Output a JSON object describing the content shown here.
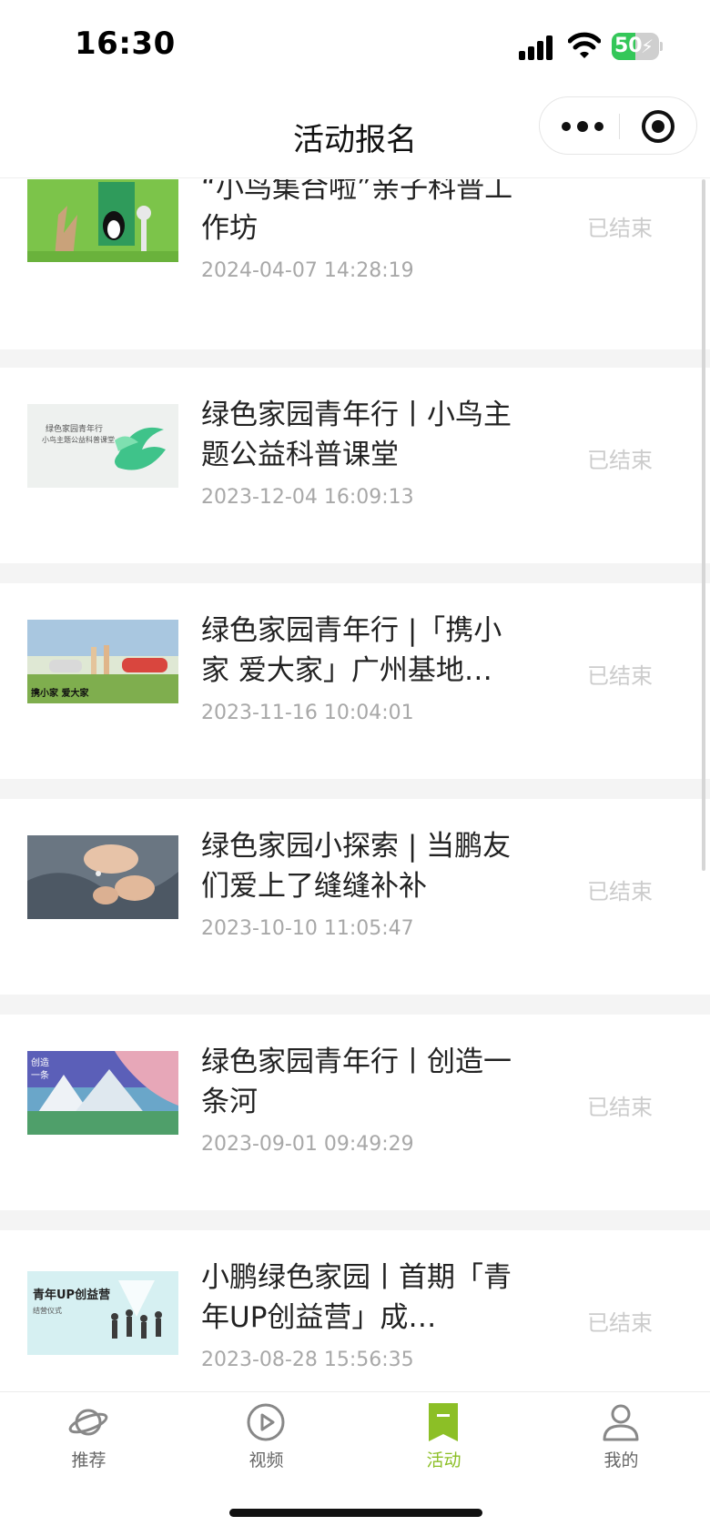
{
  "status_bar": {
    "time": "16:30",
    "battery": "50",
    "battery_level": 0.5
  },
  "nav": {
    "title": "活动报名"
  },
  "activities": [
    {
      "title": "“小鸟集合啦”亲子科普工作坊",
      "date": "2024-04-07 14:28:19",
      "status": "已结束",
      "thumb_label": ""
    },
    {
      "title": "绿色家园青年行丨小鸟主题公益科普课堂",
      "date": "2023-12-04 16:09:13",
      "status": "已结束",
      "thumb_label": "绿色家园青年行\n小鸟主题公益科普课堂"
    },
    {
      "title": "绿色家园青年行 |「携小家 爱大家」广州基地…",
      "date": "2023-11-16 10:04:01",
      "status": "已结束",
      "thumb_label": "携小家 爱大家"
    },
    {
      "title": "绿色家园小探索 | 当鹏友们爱上了缝缝补补",
      "date": "2023-10-10 11:05:47",
      "status": "已结束",
      "thumb_label": ""
    },
    {
      "title": "绿色家园青年行丨创造一条河",
      "date": "2023-09-01 09:49:29",
      "status": "已结束",
      "thumb_label": "创造一条河"
    },
    {
      "title": "小鹏绿色家园丨首期「青年UP创益营」成…",
      "date": "2023-08-28 15:56:35",
      "status": "已结束",
      "thumb_label": "青年UP创益营"
    }
  ],
  "tabs": [
    {
      "label": "推荐",
      "icon": "planet-icon",
      "active": false
    },
    {
      "label": "视频",
      "icon": "play-icon",
      "active": false
    },
    {
      "label": "活动",
      "icon": "bookmark-icon",
      "active": true
    },
    {
      "label": "我的",
      "icon": "user-icon",
      "active": false
    }
  ],
  "colors": {
    "accent": "#8cbf26",
    "status_done": "#cccccc",
    "date": "#a8a8a8"
  }
}
